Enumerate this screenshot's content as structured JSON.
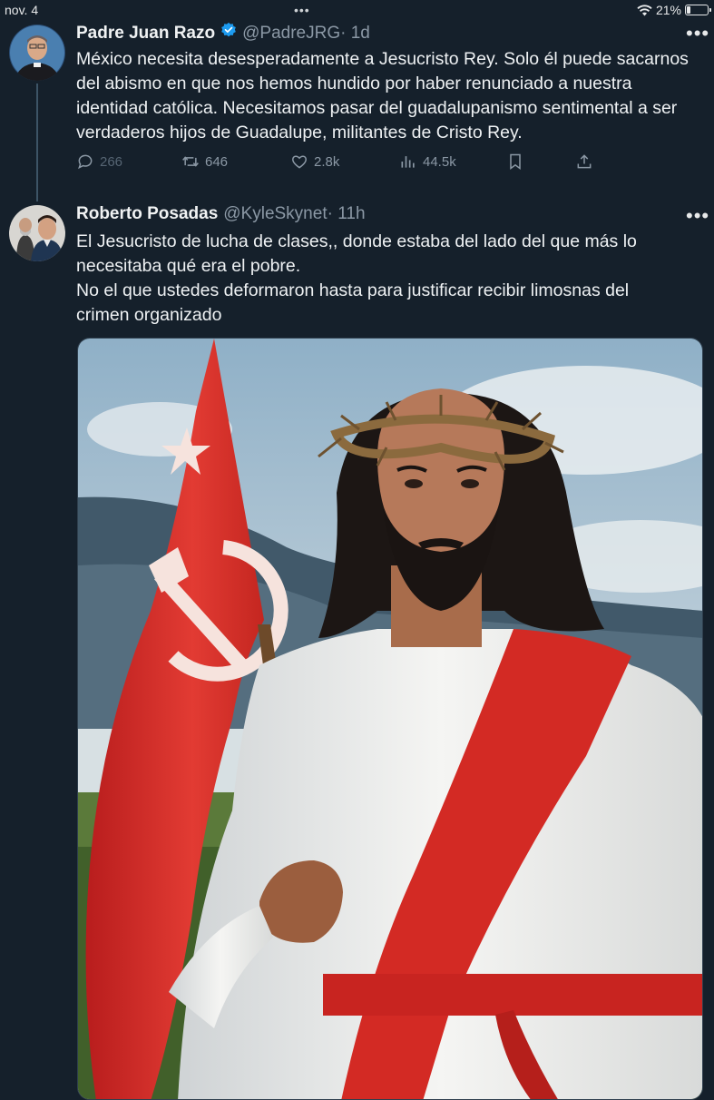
{
  "status_bar": {
    "date": "nov. 4",
    "battery": "21%",
    "battery_level": 0.21
  },
  "tweet1": {
    "name": "Padre Juan Razo",
    "handle": "@PadreJRG",
    "time": "· 1d",
    "text": "México necesita desesperadamente a Jesucristo Rey. Solo él puede sacarnos del abismo en que nos hemos hundido por haber renunciado a nuestra identidad católica. Necesitamos pasar del guadalupanismo sentimental a ser verdaderos hijos de Guadalupe, militantes de Cristo Rey.",
    "replies": "266",
    "reposts": "646",
    "likes": "2.8k",
    "views": "44.5k",
    "more": "•••"
  },
  "tweet2": {
    "name": "Roberto Posadas",
    "handle": "@KyleSkynet",
    "time": "· 11h",
    "text": "El Jesucristo de lucha de clases,, donde estaba del lado del que más lo\nnecesitaba qué  era el pobre.\nNo el que ustedes deformaron hasta para justificar recibir limosnas del\ncrimen organizado",
    "more": "•••"
  },
  "icons": [
    "wifi-icon",
    "battery-icon",
    "verified-badge-icon",
    "reply-icon",
    "repost-icon",
    "like-icon",
    "views-icon",
    "bookmark-icon",
    "share-icon",
    "more-icon"
  ],
  "colors": {
    "background": "#15202b",
    "verified": "#1d9bf0",
    "muted": "#8b98a5"
  }
}
